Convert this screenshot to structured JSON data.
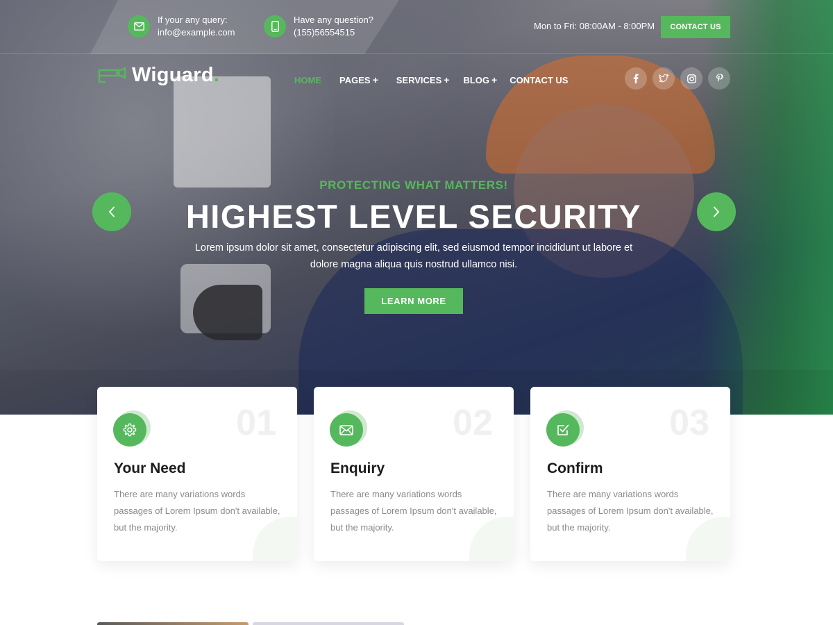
{
  "topbar": {
    "email_label": "If your any query:",
    "email_value": "info@example.com",
    "phone_label": "Have any question?",
    "phone_value": "(155)56554515",
    "hours": "Mon to Fri: 08:00AM - 8:00PM",
    "contact_button": "CONTACT US"
  },
  "brand": {
    "name": "Wiguard",
    "dot": "."
  },
  "nav": {
    "items": [
      {
        "label": "HOME",
        "active": true
      },
      {
        "label": "PAGES",
        "plus": "+"
      },
      {
        "label": "SERVICES",
        "plus": "+"
      },
      {
        "label": "BLOG",
        "plus": "+"
      },
      {
        "label": "CONTACT US"
      }
    ]
  },
  "social": [
    "facebook-icon",
    "twitter-icon",
    "instagram-icon",
    "pinterest-icon"
  ],
  "hero": {
    "kicker": "PROTECTING WHAT MATTERS!",
    "headline": "HIGHEST LEVEL SECURITY",
    "subtext": "Lorem ipsum dolor sit amet, consectetur adipiscing elit, sed eiusmod tempor incididunt ut labore et dolore magna aliqua quis nostrud ullamco nisi.",
    "button": "LEARN MORE"
  },
  "steps": [
    {
      "num": "01",
      "title": "Your Need",
      "icon": "gear-icon",
      "desc": "There are many variations words passages of Lorem Ipsum don't available, but the majority."
    },
    {
      "num": "02",
      "title": "Enquiry",
      "icon": "mail-icon",
      "desc": "There are many variations words passages of Lorem Ipsum don't available, but the majority."
    },
    {
      "num": "03",
      "title": "Confirm",
      "icon": "checkbox-icon",
      "desc": "There are many variations words passages of Lorem Ipsum don't available, but the majority."
    }
  ],
  "colors": {
    "accent": "#56b85c",
    "text_dark": "#1c1c1c",
    "text_muted": "#8a8a8a"
  }
}
